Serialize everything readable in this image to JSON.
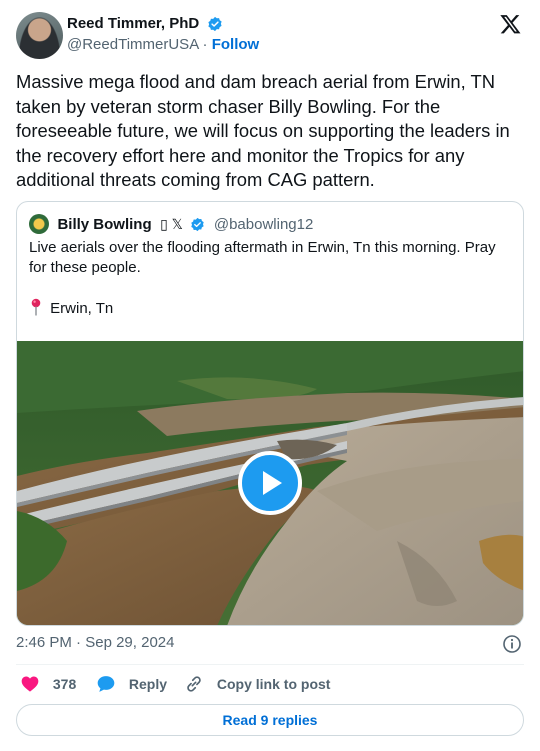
{
  "author": {
    "name": "Reed Timmer, PhD",
    "handle": "@ReedTimmerUSA",
    "separator": "·",
    "follow_label": "Follow"
  },
  "tweet": {
    "text": "Massive mega flood and dam breach aerial from Erwin, TN taken by veteran storm chaser Billy Bowling. For the foreseeable future, we will focus on supporting the leaders in the recovery effort here and monitor the Tropics for any additional threats coming from CAG pattern."
  },
  "quote": {
    "name": "Billy Bowling",
    "extra_glyphs": "▯ 𝕏",
    "handle": "@babowling12",
    "text": "Live aerials over the flooding aftermath in Erwin, Tn this morning. Pray for these people.",
    "location": "Erwin, Tn",
    "media_icon": "play-icon"
  },
  "meta": {
    "time": "2:46 PM",
    "separator": "·",
    "date": "Sep 29, 2024"
  },
  "actions": {
    "like_count": "378",
    "reply_label": "Reply",
    "copy_label": "Copy link to post"
  },
  "read_replies_label": "Read 9 replies",
  "colors": {
    "accent": "#1d9bf0",
    "link": "#006fd6",
    "like": "#f91880",
    "secondary_text": "#536471",
    "border": "#cfd9de"
  },
  "icons": [
    "verified-badge-icon",
    "x-logo-icon",
    "pin-icon",
    "play-icon",
    "info-icon",
    "heart-icon",
    "reply-bubble-icon",
    "link-icon"
  ]
}
